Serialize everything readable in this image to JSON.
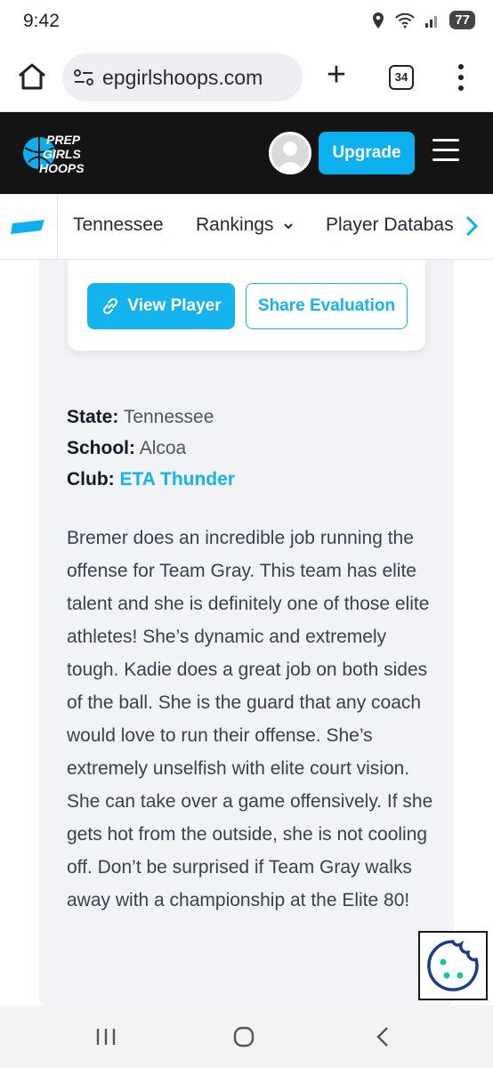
{
  "status": {
    "time": "9:42",
    "battery": "77"
  },
  "browser": {
    "url": "epgirlshoops.com",
    "tab_count": "34"
  },
  "header": {
    "logo_lines": [
      "PREP",
      "GIRLS",
      "HOOPS"
    ],
    "upgrade_label": "Upgrade"
  },
  "subnav": {
    "state": "Tennessee",
    "rankings": "Rankings",
    "player_database": "Player Database"
  },
  "actions": {
    "view_player": "View Player",
    "share_evaluation": "Share Evaluation"
  },
  "player_info": {
    "state_label": "State:",
    "state_value": "Tennessee",
    "school_label": "School:",
    "school_value": "Alcoa",
    "club_label": "Club:",
    "club_value": "ETA Thunder"
  },
  "evaluation": "Bremer does an incredible job running the offense for Team Gray. This team has elite talent and she is definitely one of those elite athletes! She’s dynamic and extremely tough. Kadie does a great job on both sides of the ball. She is the guard that any coach would love to run their offense. She’s extremely unselfish with elite court vision. She can take over a game offensively. If she gets hot from the outside, she is not cooling off. Don’t be surprised if Team Gray walks away with a championship at the Elite 80!",
  "colors": {
    "accent": "#14b3ee",
    "header_bg": "#141414",
    "content_bg": "#f1f3f6"
  },
  "icons": [
    "location-icon",
    "wifi-icon",
    "signal-icon",
    "home-icon",
    "site-info-icon",
    "new-tab-icon",
    "more-icon",
    "avatar-icon",
    "menu-icon",
    "state-map-icon",
    "chevron-down-icon",
    "chevron-right-icon",
    "link-icon",
    "cookie-icon",
    "recent-apps-icon",
    "home-nav-icon",
    "back-icon"
  ]
}
